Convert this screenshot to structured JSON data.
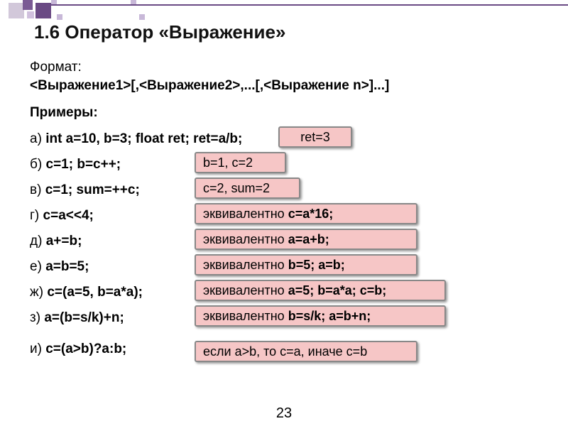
{
  "title": "1.6 Оператор «Выражение»",
  "format_label": "Формат:",
  "format_syntax": "<Выражение1>[,<Выражение2>,...[,<Выражение n>]...]",
  "examples_label": "Примеры:",
  "rows": {
    "a": {
      "tag": "а) ",
      "code": "int  a=10, b=3; float ret; ret=a/b;",
      "result_plain": "ret=3",
      "result_bold": ""
    },
    "b": {
      "tag": "б) ",
      "code": "c=1;   b=c++;",
      "result_plain": "b=1,  c=2",
      "result_bold": ""
    },
    "v": {
      "tag": "в) ",
      "code": "c=1;    sum=++c;",
      "result_plain": "c=2, sum=2",
      "result_bold": ""
    },
    "g": {
      "tag": "г) ",
      "code": "c=a<<4;",
      "result_plain": "эквивалентно ",
      "result_bold": "c=a*16;"
    },
    "d": {
      "tag": "д) ",
      "code": "a+=b;",
      "result_plain": "эквивалентно ",
      "result_bold": "a=a+b;"
    },
    "e": {
      "tag": "е) ",
      "code": "a=b=5;",
      "result_plain": "эквивалентно ",
      "result_bold": "b=5; a=b;"
    },
    "zh": {
      "tag": "ж) ",
      "code": "c=(a=5, b=a*a);",
      "result_plain": "эквивалентно ",
      "result_bold": "a=5; b=a*a; c=b;"
    },
    "z": {
      "tag": "з) ",
      "code": "a=(b=s/k)+n;",
      "result_plain": "эквивалентно ",
      "result_bold": "b=s/k; a=b+n;"
    },
    "i": {
      "tag": "и) ",
      "code": "c=(a>b)?a:b;",
      "result_plain": "если a>b, то c=a, иначе c=b",
      "result_bold": ""
    }
  },
  "page_number": "23"
}
